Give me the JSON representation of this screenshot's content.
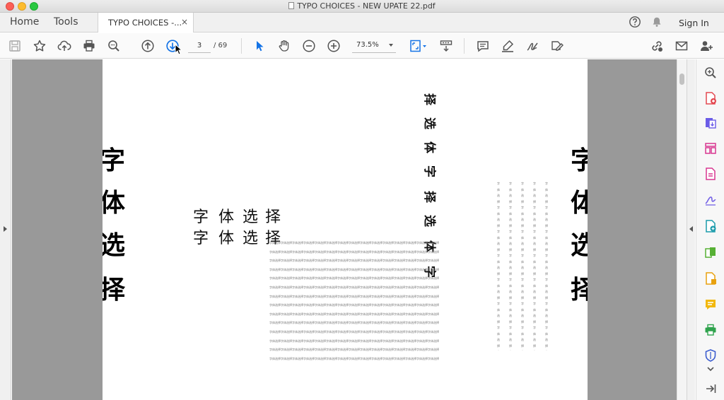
{
  "window": {
    "title": "TYPO CHOICES - NEW UPATE 22.pdf"
  },
  "tabs": {
    "home": "Home",
    "tools": "Tools",
    "document_tab": "TYPO CHOICES -...",
    "close_glyph": "×",
    "sign_in": "Sign In"
  },
  "toolbar": {
    "current_page": "3",
    "page_total": "/ 69",
    "zoom": "73.5%"
  },
  "document": {
    "left_big": [
      "字",
      "体",
      "选",
      "择"
    ],
    "right_big": [
      "字",
      "体",
      "选",
      "择"
    ],
    "middle_row1": [
      "字",
      "体",
      "选",
      "择"
    ],
    "middle_row2": [
      "字",
      "体",
      "选",
      "择"
    ],
    "vertical_rotated": [
      "字",
      "体",
      "选",
      "择",
      "字",
      "体",
      "选",
      "择"
    ],
    "grid_unit": "字体选择",
    "colors": {
      "viewer_bg": "#999999",
      "accent": "#1473e6"
    }
  },
  "icons": {
    "toolbar": [
      "save-icon",
      "star-icon",
      "cloud-upload-icon",
      "print-icon",
      "search-zoom-icon",
      "previous-page-icon",
      "next-page-icon",
      "select-arrow-icon",
      "hand-icon",
      "zoom-out-icon",
      "zoom-in-icon",
      "fit-page-icon",
      "scroll-mode-icon",
      "comment-icon",
      "highlight-icon",
      "sign-icon",
      "fill-sign-icon",
      "link-icon",
      "mail-icon",
      "add-user-icon"
    ],
    "right_pane": [
      "search-zoom-icon",
      "create-pdf-icon",
      "export-pdf-icon",
      "organize-pages-icon",
      "edit-pdf-icon",
      "sign-pen-icon",
      "enhance-scans-icon",
      "compare-icon",
      "protect-file-icon",
      "comment-icon",
      "print-production-icon",
      "shield-icon",
      "chevron-down-icon",
      "expand-pane-icon"
    ]
  }
}
